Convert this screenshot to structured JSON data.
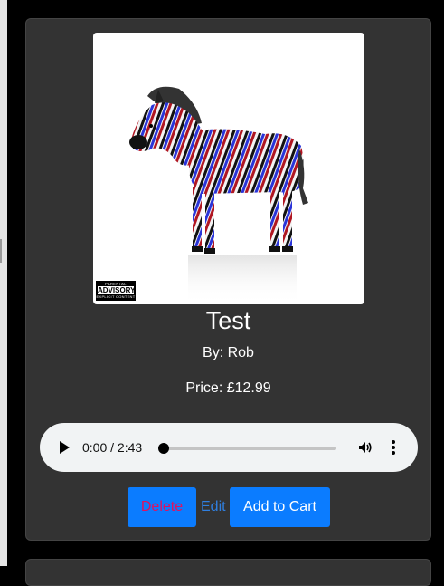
{
  "product": {
    "title": "Test",
    "artist": "By: Rob",
    "price": "Price: £12.99",
    "cover_art": {
      "advisory_line1": "PARENTAL",
      "advisory_line2": "ADVISORY",
      "advisory_line3": "EXPLICIT CONTENT"
    }
  },
  "audio": {
    "time": "0:00 / 2:43",
    "progress": 0
  },
  "actions": {
    "delete_label": "Delete",
    "edit_label": "Edit",
    "cart_label": "Add to Cart"
  },
  "icons": {
    "play": "play-icon",
    "volume": "volume-icon",
    "more": "more-vertical-icon"
  },
  "colors": {
    "background": "#000000",
    "card": "#333333",
    "primary_button": "#0b7cff",
    "delete_text": "#e0115f",
    "link": "#2f7fe0",
    "player_bg": "#f1f3f4"
  }
}
